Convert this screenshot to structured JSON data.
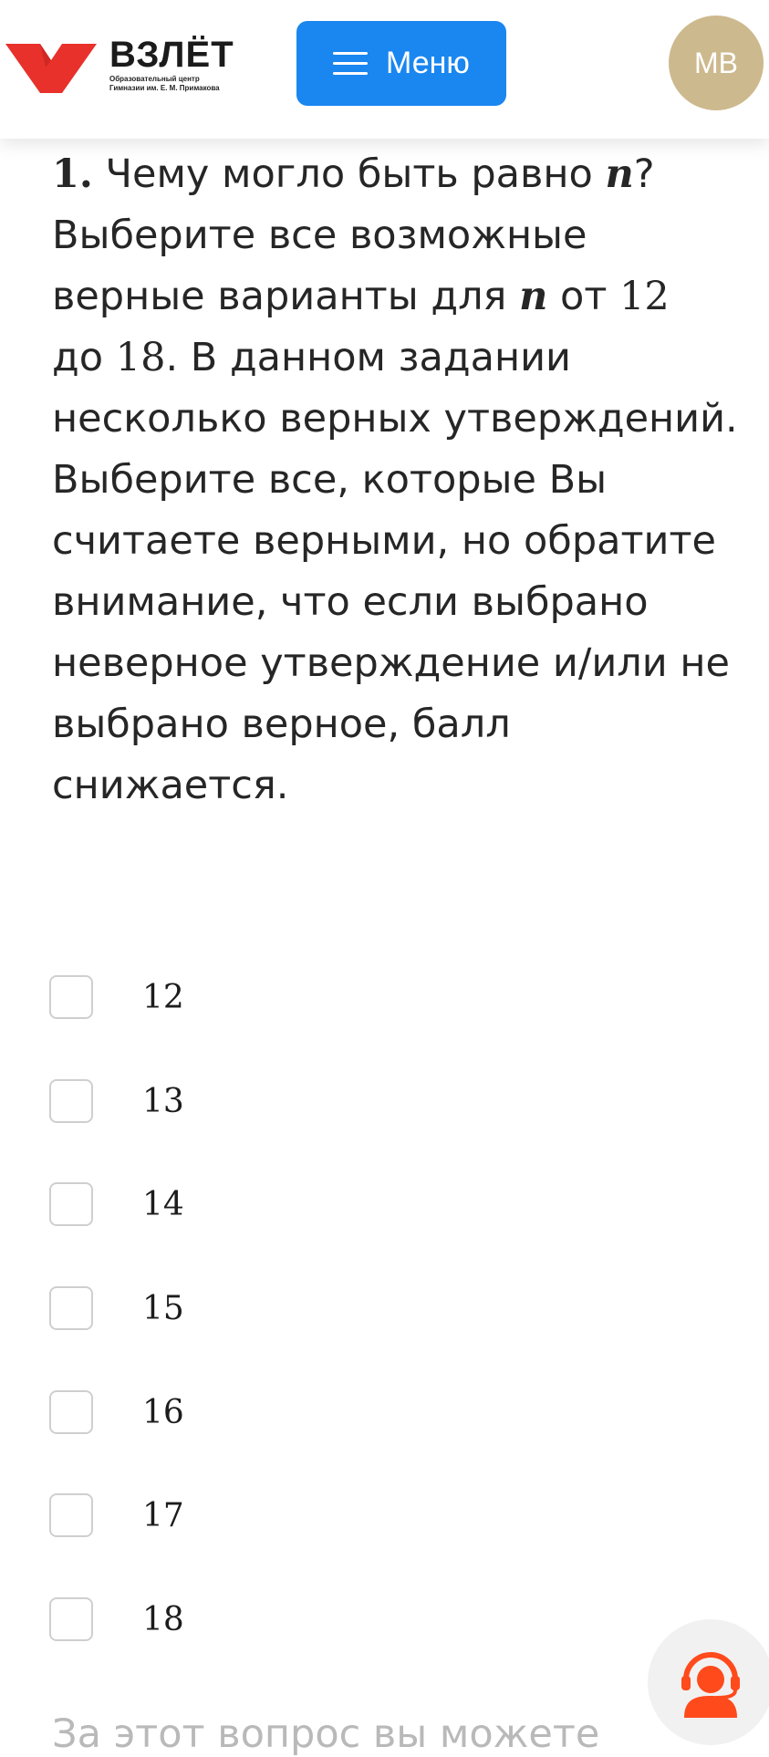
{
  "header": {
    "logo_title": "ВЗЛЁТ",
    "logo_subtitle_line1": "Образовательный центр",
    "logo_subtitle_line2": "Гимназии им. Е. М. Примакова",
    "menu_label": "Меню",
    "avatar_initials": "МВ",
    "logo_color": "#e8312b",
    "menu_color": "#1a86f0",
    "avatar_color": "#cdb98e"
  },
  "question": {
    "number": "1.",
    "part1": " Чему могло быть равно ",
    "var": "n",
    "part2": "? Выберите все возможные верные варианты для ",
    "part3": " от ",
    "min": "12",
    "part4": " до ",
    "max": "18",
    "part5": ". В данном задании несколько верных утверждений. Выберите все, которые Вы считаете верными, но обратите внимание, что если выбрано неверное утверждение и/или не выбрано верное, балл снижается."
  },
  "options": [
    "12",
    "13",
    "14",
    "15",
    "16",
    "17",
    "18"
  ],
  "footer_text": "За этот вопрос вы можете",
  "support_icon": "support-headset-icon",
  "support_color": "#ff4a1c"
}
